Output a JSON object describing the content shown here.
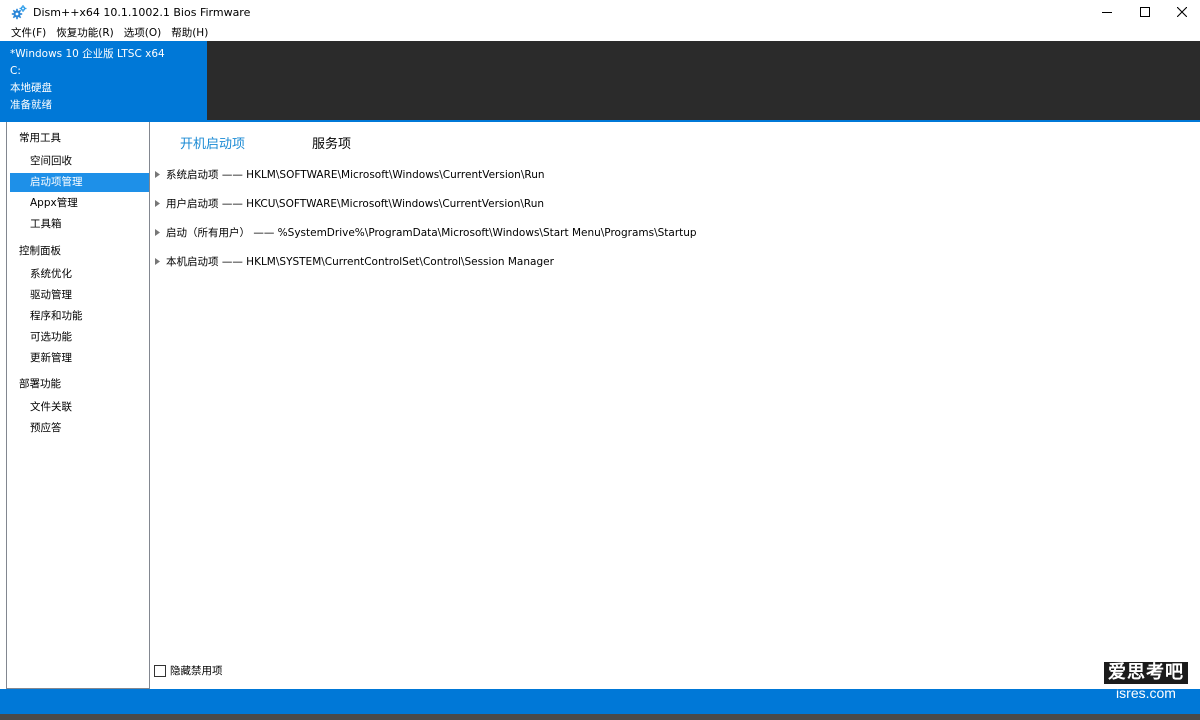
{
  "window": {
    "title": "Dism++x64 10.1.1002.1 Bios Firmware",
    "icon": "gears-icon",
    "controls": [
      "minimize-icon",
      "maximize-icon",
      "close-icon"
    ]
  },
  "menu": [
    {
      "label": "文件(F)"
    },
    {
      "label": "恢复功能(R)"
    },
    {
      "label": "选项(O)"
    },
    {
      "label": "帮助(H)"
    }
  ],
  "info": {
    "os": "*Windows 10 企业版 LTSC x64",
    "drive": "C:",
    "disk": "本地硬盘",
    "status": "准备就绪"
  },
  "sidebar": {
    "groups": [
      {
        "title": "常用工具",
        "items": [
          {
            "label": "空间回收",
            "selected": false
          },
          {
            "label": "启动项管理",
            "selected": true
          },
          {
            "label": "Appx管理",
            "selected": false
          },
          {
            "label": "工具箱",
            "selected": false
          }
        ]
      },
      {
        "title": "控制面板",
        "items": [
          {
            "label": "系统优化",
            "selected": false
          },
          {
            "label": "驱动管理",
            "selected": false
          },
          {
            "label": "程序和功能",
            "selected": false
          },
          {
            "label": "可选功能",
            "selected": false
          },
          {
            "label": "更新管理",
            "selected": false
          }
        ]
      },
      {
        "title": "部署功能",
        "items": [
          {
            "label": "文件关联",
            "selected": false
          },
          {
            "label": "预应答",
            "selected": false
          }
        ]
      }
    ]
  },
  "main": {
    "tabs": [
      {
        "label": "开机启动项",
        "active": true
      },
      {
        "label": "服务项",
        "active": false
      }
    ],
    "tree": [
      {
        "label": "系统启动项 —— HKLM\\SOFTWARE\\Microsoft\\Windows\\CurrentVersion\\Run"
      },
      {
        "label": "用户启动项 —— HKCU\\SOFTWARE\\Microsoft\\Windows\\CurrentVersion\\Run"
      },
      {
        "label": "启动（所有用户） —— %SystemDrive%\\ProgramData\\Microsoft\\Windows\\Start Menu\\Programs\\Startup"
      },
      {
        "label": "本机启动项 —— HKLM\\SYSTEM\\CurrentControlSet\\Control\\Session Manager"
      }
    ],
    "hide_disabled_label": "隐藏禁用项",
    "hide_disabled_checked": false
  },
  "watermark": {
    "line1": "爱思考吧",
    "line2": "isres.com"
  },
  "colors": {
    "accent": "#0078d7",
    "selected": "#1e90e8",
    "active_tab": "#1a8ad4",
    "header_dark": "#2b2b2b"
  }
}
